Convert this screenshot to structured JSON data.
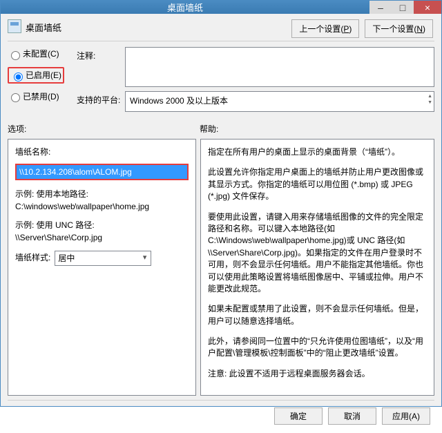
{
  "window": {
    "title": "桌面墙纸",
    "minimize": "–",
    "maximize": "□",
    "close": "×"
  },
  "header": {
    "icon": "image-policy-icon",
    "name": "桌面墙纸",
    "prev_setting": "上一个设置(P)",
    "next_setting": "下一个设置(N)",
    "prev_key": "P",
    "next_key": "N"
  },
  "config": {
    "not_configured": "未配置(C)",
    "enabled": "已启用(E)",
    "disabled": "已禁用(D)",
    "selected": "enabled",
    "comment_label": "注释:",
    "comment_value": "",
    "platform_label": "支持的平台:",
    "platform_value": "Windows 2000 及以上版本"
  },
  "mid": {
    "options": "选项:",
    "help": "帮助:"
  },
  "options": {
    "name_label": "墙纸名称:",
    "path_value": "\\\\10.2.134.208\\alom\\ALOM.jpg",
    "hint_local_label": "示例: 使用本地路径:",
    "hint_local_value": "C:\\windows\\web\\wallpaper\\home.jpg",
    "hint_unc_label": "示例: 使用 UNC 路径:",
    "hint_unc_value": "\\\\Server\\Share\\Corp.jpg",
    "style_label": "墙纸样式:",
    "style_value": "居中"
  },
  "help": {
    "p1": "指定在所有用户的桌面上显示的桌面背景（“墙纸”）。",
    "p2": "此设置允许你指定用户桌面上的墙纸并防止用户更改图像或其显示方式。你指定的墙纸可以用位图 (*.bmp) 或 JPEG (*.jpg) 文件保存。",
    "p3": "要使用此设置，请键入用来存储墙纸图像的文件的完全限定路径和名称。可以键入本地路径(如 C:\\Windows\\web\\wallpaper\\home.jpg)或 UNC 路径(如 \\\\Server\\Share\\Corp.jpg)。如果指定的文件在用户登录时不可用，则不会显示任何墙纸。用户不能指定其他墙纸。你也可以使用此策略设置将墙纸图像居中、平铺或拉伸。用户不能更改此规范。",
    "p4": "如果未配置或禁用了此设置，则不会显示任何墙纸。但是，用户可以随意选择墙纸。",
    "p5": "此外，请参阅同一位置中的“只允许使用位图墙纸”，以及“用户配置\\管理模板\\控制面板”中的“阻止更改墙纸”设置。",
    "p6": "注意: 此设置不适用于远程桌面服务器会话。"
  },
  "footer": {
    "ok": "确定",
    "cancel": "取消",
    "apply": "应用(A)"
  }
}
